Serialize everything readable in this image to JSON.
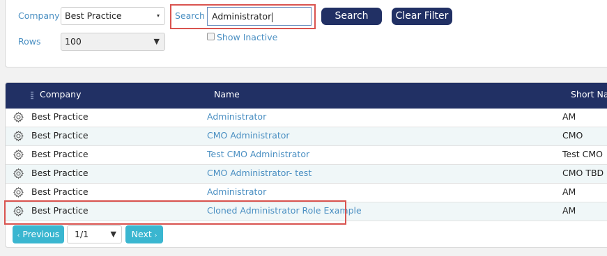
{
  "filters": {
    "company_label": "Company",
    "company_value": "Best Practice",
    "rows_label": "Rows",
    "rows_value": "100",
    "search_label": "Search",
    "search_value": "Administrator",
    "search_button": "Search",
    "clear_button": "Clear Filter",
    "show_inactive_label": "Show Inactive"
  },
  "table": {
    "headers": {
      "company": "Company",
      "name": "Name",
      "short_name": "Short Nar"
    },
    "rows": [
      {
        "company": "Best Practice",
        "name": "Administrator",
        "short_name": "AM"
      },
      {
        "company": "Best Practice",
        "name": "CMO Administrator",
        "short_name": "CMO"
      },
      {
        "company": "Best Practice",
        "name": "Test CMO Administrator",
        "short_name": "Test CMO"
      },
      {
        "company": "Best Practice",
        "name": "CMO Administrator- test",
        "short_name": "CMO TBD"
      },
      {
        "company": "Best Practice",
        "name": "Administrator",
        "short_name": "AM"
      },
      {
        "company": "Best Practice",
        "name": "Cloned Administrator Role Example",
        "short_name": "AM"
      }
    ]
  },
  "pager": {
    "previous_label": "Previous",
    "next_label": "Next",
    "page_value": "1/1"
  },
  "colors": {
    "header_bg": "#213064",
    "link": "#4a8fc2",
    "highlight": "#d9534f",
    "pager_button": "#3ab6d0"
  }
}
